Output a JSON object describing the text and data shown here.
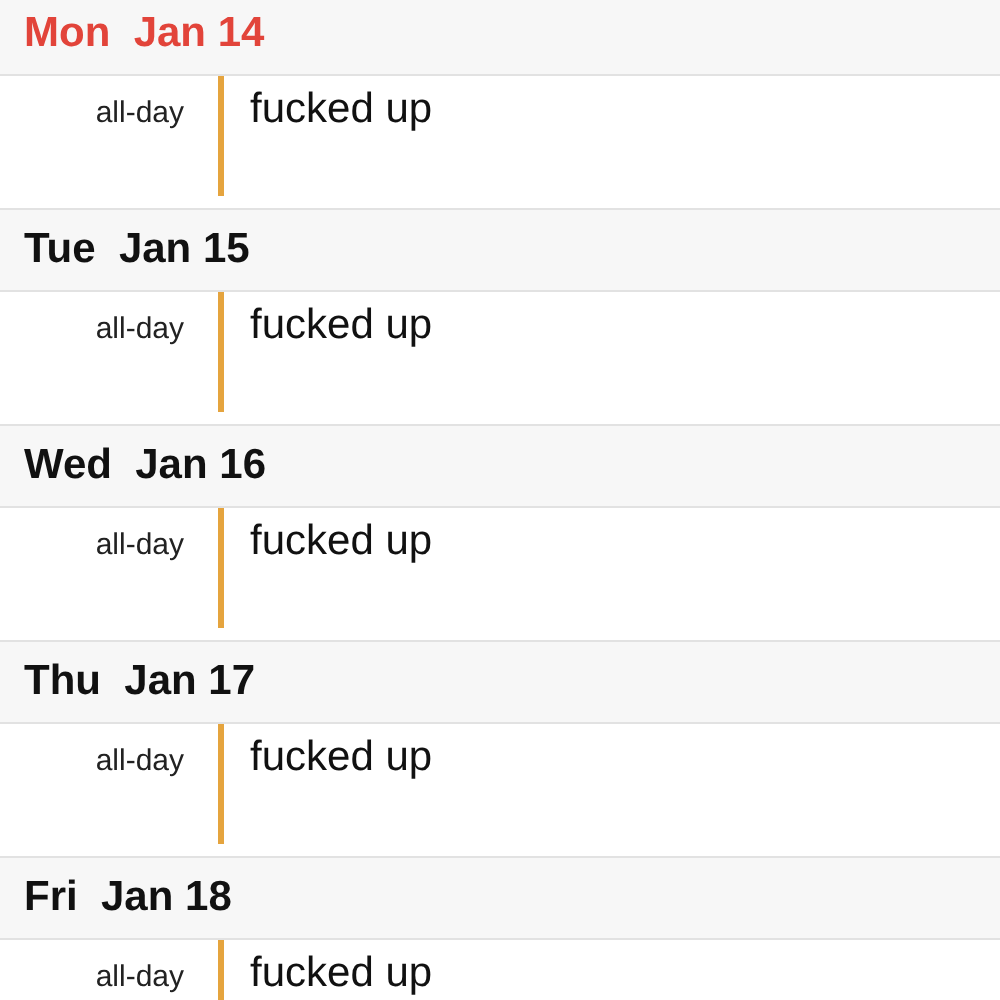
{
  "days": [
    {
      "label": "Mon  Jan 14",
      "today": true,
      "events": [
        {
          "time": "all-day",
          "title": "fucked up",
          "color": "#e5a43e"
        }
      ]
    },
    {
      "label": "Tue  Jan 15",
      "today": false,
      "events": [
        {
          "time": "all-day",
          "title": "fucked up",
          "color": "#e5a43e"
        }
      ]
    },
    {
      "label": "Wed  Jan 16",
      "today": false,
      "events": [
        {
          "time": "all-day",
          "title": "fucked up",
          "color": "#e5a43e"
        }
      ]
    },
    {
      "label": "Thu  Jan 17",
      "today": false,
      "events": [
        {
          "time": "all-day",
          "title": "fucked up",
          "color": "#e5a43e"
        }
      ]
    },
    {
      "label": "Fri  Jan 18",
      "today": false,
      "events": [
        {
          "time": "all-day",
          "title": "fucked up",
          "color": "#e5a43e"
        }
      ]
    }
  ]
}
